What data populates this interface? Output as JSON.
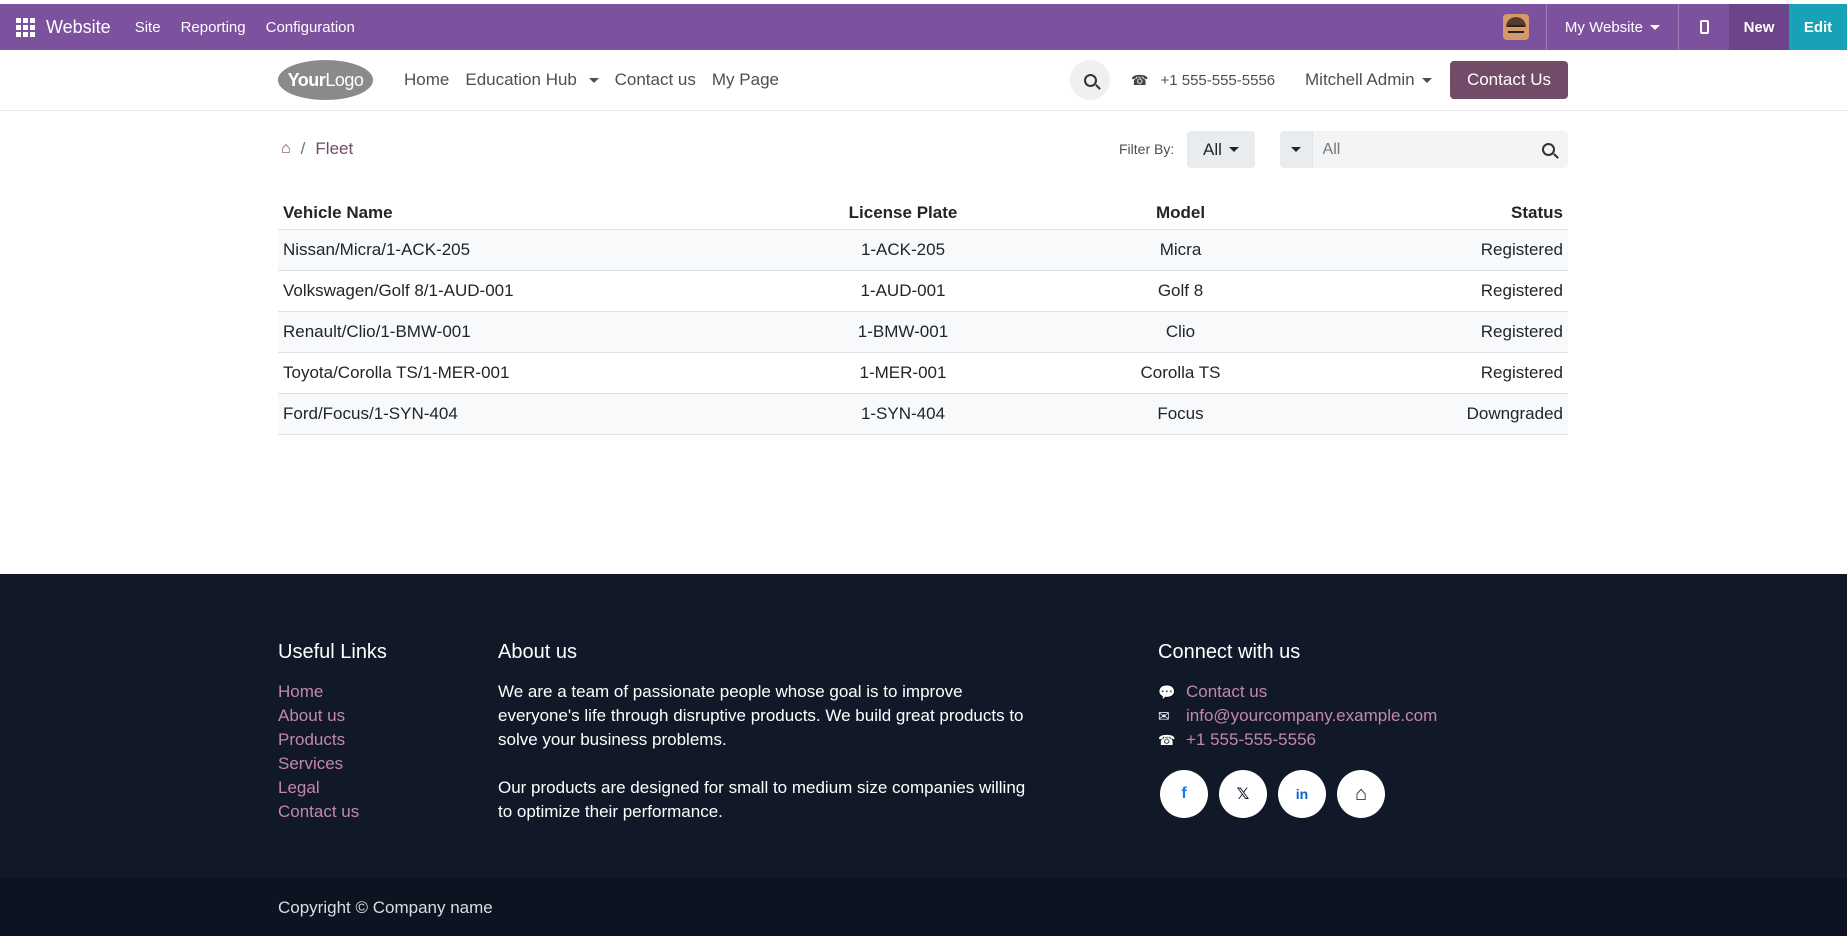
{
  "adminbar": {
    "app_name": "Website",
    "menu": [
      "Site",
      "Reporting",
      "Configuration"
    ],
    "website_selector": "My Website",
    "new_label": "New",
    "edit_label": "Edit"
  },
  "header": {
    "logo_text_bold": "Your",
    "logo_text": "Logo",
    "nav": [
      "Home",
      "Education Hub",
      "Contact us",
      "My Page"
    ],
    "phone": "+1 555-555-5556",
    "user": "Mitchell Admin",
    "contact_button": "Contact Us"
  },
  "breadcrumb": {
    "current": "Fleet"
  },
  "filters": {
    "label": "Filter By:",
    "selected": "All",
    "search_placeholder": "All"
  },
  "table": {
    "columns": [
      "Vehicle Name",
      "License Plate",
      "Model",
      "Status"
    ],
    "rows": [
      [
        "Nissan/Micra/1-ACK-205",
        "1-ACK-205",
        "Micra",
        "Registered"
      ],
      [
        "Volkswagen/Golf 8/1-AUD-001",
        "1-AUD-001",
        "Golf 8",
        "Registered"
      ],
      [
        "Renault/Clio/1-BMW-001",
        "1-BMW-001",
        "Clio",
        "Registered"
      ],
      [
        "Toyota/Corolla TS/1-MER-001",
        "1-MER-001",
        "Corolla TS",
        "Registered"
      ],
      [
        "Ford/Focus/1-SYN-404",
        "1-SYN-404",
        "Focus",
        "Downgraded"
      ]
    ]
  },
  "footer": {
    "useful_links_title": "Useful Links",
    "useful_links": [
      "Home",
      "About us",
      "Products",
      "Services",
      "Legal",
      "Contact us"
    ],
    "about_title": "About us",
    "about_p1": "We are a team of passionate people whose goal is to improve everyone's life through disruptive products. We build great products to solve your business problems.",
    "about_p2": "Our products are designed for small to medium size companies willing to optimize their performance.",
    "connect_title": "Connect with us",
    "connect": {
      "contact": "Contact us",
      "email": "info@yourcompany.example.com",
      "phone": "+1 555-555-5556"
    },
    "socials": [
      {
        "icon": "facebook-icon",
        "glyph": "f"
      },
      {
        "icon": "x-twitter-icon",
        "glyph": "𝕏"
      },
      {
        "icon": "linkedin-icon",
        "glyph": "in"
      },
      {
        "icon": "home-icon",
        "glyph": "⌂"
      }
    ],
    "copyright": "Copyright © Company name"
  },
  "colors": {
    "admin_bar": "#7c519d",
    "primary": "#714b67",
    "edit": "#17a2b8",
    "footer_bg": "#111827",
    "link": "#c287b0"
  }
}
